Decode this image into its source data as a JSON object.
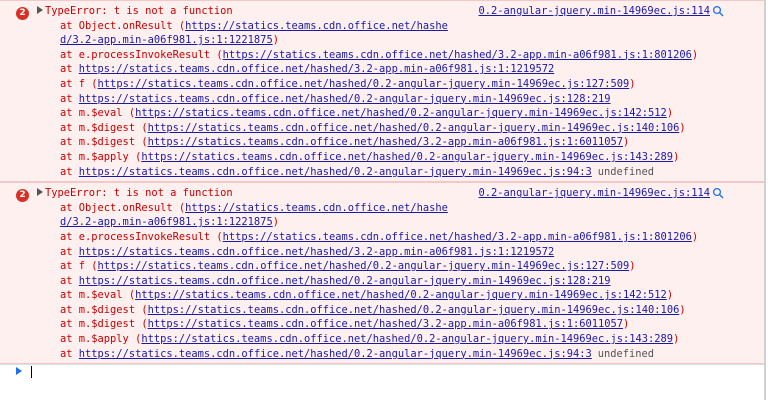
{
  "errors": [
    {
      "count": "2",
      "message": "TypeError: t is not a function",
      "source": "0.2-angular-jquery.min-14969ec.js:114",
      "frames": [
        {
          "prefix": "at Object.onResult (",
          "url": "https://statics.teams.cdn.office.net/hashed/3.2-app.min-a06f981.js:1:1221875",
          "suffix": ")"
        },
        {
          "prefix": "at e.processInvokeResult (",
          "url": "https://statics.teams.cdn.office.net/hashed/3.2-app.min-a06f981.js:1:801206",
          "suffix": ")"
        },
        {
          "prefix": "at ",
          "url": "https://statics.teams.cdn.office.net/hashed/3.2-app.min-a06f981.js:1:1219572",
          "suffix": ""
        },
        {
          "prefix": "at f (",
          "url": "https://statics.teams.cdn.office.net/hashed/0.2-angular-jquery.min-14969ec.js:127:509",
          "suffix": ")"
        },
        {
          "prefix": "at ",
          "url": "https://statics.teams.cdn.office.net/hashed/0.2-angular-jquery.min-14969ec.js:128:219",
          "suffix": ""
        },
        {
          "prefix": "at m.$eval (",
          "url": "https://statics.teams.cdn.office.net/hashed/0.2-angular-jquery.min-14969ec.js:142:512",
          "suffix": ")"
        },
        {
          "prefix": "at m.$digest (",
          "url": "https://statics.teams.cdn.office.net/hashed/0.2-angular-jquery.min-14969ec.js:140:106",
          "suffix": ")"
        },
        {
          "prefix": "at m.$digest (",
          "url": "https://statics.teams.cdn.office.net/hashed/3.2-app.min-a06f981.js:1:6011057",
          "suffix": ")"
        },
        {
          "prefix": "at m.$apply (",
          "url": "https://statics.teams.cdn.office.net/hashed/0.2-angular-jquery.min-14969ec.js:143:289",
          "suffix": ")"
        },
        {
          "prefix": "at ",
          "url": "https://statics.teams.cdn.office.net/hashed/0.2-angular-jquery.min-14969ec.js:94:3",
          "suffix": ""
        }
      ],
      "trailing": "undefined"
    },
    {
      "count": "2",
      "message": "TypeError: t is not a function",
      "source": "0.2-angular-jquery.min-14969ec.js:114",
      "frames": [
        {
          "prefix": "at Object.onResult (",
          "url": "https://statics.teams.cdn.office.net/hashed/3.2-app.min-a06f981.js:1:1221875",
          "suffix": ")"
        },
        {
          "prefix": "at e.processInvokeResult (",
          "url": "https://statics.teams.cdn.office.net/hashed/3.2-app.min-a06f981.js:1:801206",
          "suffix": ")"
        },
        {
          "prefix": "at ",
          "url": "https://statics.teams.cdn.office.net/hashed/3.2-app.min-a06f981.js:1:1219572",
          "suffix": ""
        },
        {
          "prefix": "at f (",
          "url": "https://statics.teams.cdn.office.net/hashed/0.2-angular-jquery.min-14969ec.js:127:509",
          "suffix": ")"
        },
        {
          "prefix": "at ",
          "url": "https://statics.teams.cdn.office.net/hashed/0.2-angular-jquery.min-14969ec.js:128:219",
          "suffix": ""
        },
        {
          "prefix": "at m.$eval (",
          "url": "https://statics.teams.cdn.office.net/hashed/0.2-angular-jquery.min-14969ec.js:142:512",
          "suffix": ")"
        },
        {
          "prefix": "at m.$digest (",
          "url": "https://statics.teams.cdn.office.net/hashed/0.2-angular-jquery.min-14969ec.js:140:106",
          "suffix": ")"
        },
        {
          "prefix": "at m.$digest (",
          "url": "https://statics.teams.cdn.office.net/hashed/3.2-app.min-a06f981.js:1:6011057",
          "suffix": ")"
        },
        {
          "prefix": "at m.$apply (",
          "url": "https://statics.teams.cdn.office.net/hashed/0.2-angular-jquery.min-14969ec.js:143:289",
          "suffix": ")"
        },
        {
          "prefix": "at ",
          "url": "https://statics.teams.cdn.office.net/hashed/0.2-angular-jquery.min-14969ec.js:94:3",
          "suffix": ""
        }
      ],
      "trailing": "undefined"
    }
  ],
  "icons": {
    "badge": "error-count-badge",
    "expand": "expand-triangle-icon",
    "search": "search-icon",
    "prompt": "prompt-caret-icon"
  },
  "colors": {
    "error_text": "#c80000",
    "error_bg": "#fff0f0",
    "link": "#1a1aa6",
    "badge": "#d93025",
    "muted": "#555555"
  }
}
